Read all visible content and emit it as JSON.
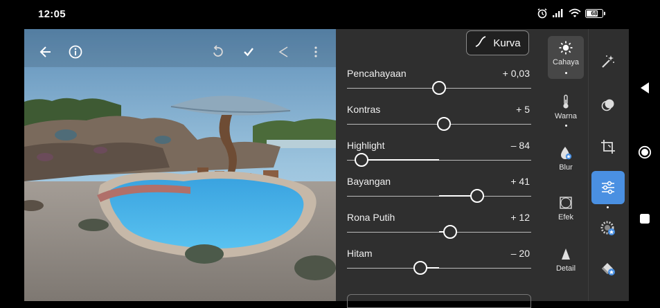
{
  "status_bar": {
    "time": "12:05",
    "battery": "68",
    "icons": [
      "alarm-icon",
      "signal-icon",
      "wifi-icon",
      "battery-icon"
    ]
  },
  "photo_toolbar": {
    "icons": [
      "back-arrow-icon",
      "info-icon",
      "undo-icon",
      "check-icon",
      "share-icon",
      "more-icon"
    ]
  },
  "panel": {
    "kurva_label": "Kurva",
    "sliders": [
      {
        "label": "Pencahayaan",
        "value": "+ 0,03",
        "amount": 0.003
      },
      {
        "label": "Kontras",
        "value": "+ 5",
        "amount": 0.05
      },
      {
        "label": "Highlight",
        "value": "– 84",
        "amount": -0.84
      },
      {
        "label": "Bayangan",
        "value": "+ 41",
        "amount": 0.41
      },
      {
        "label": "Rona Putih",
        "value": "+ 12",
        "amount": 0.12
      },
      {
        "label": "Hitam",
        "value": "– 20",
        "amount": -0.2
      }
    ]
  },
  "categories": [
    {
      "label": "Cahaya",
      "icon": "sun-icon",
      "active": true
    },
    {
      "label": "Warna",
      "icon": "thermometer-icon",
      "active": false
    },
    {
      "label": "Blur",
      "icon": "blur-drop-icon",
      "active": false
    },
    {
      "label": "Efek",
      "icon": "effects-icon",
      "active": false
    },
    {
      "label": "Detail",
      "icon": "detail-triangle-icon",
      "active": false
    }
  ],
  "tools": [
    "auto-wand-icon",
    "mask-icon",
    "crop-icon",
    "adjust-sliders-icon",
    "presets-icon",
    "healing-icon"
  ],
  "navigation": [
    "back-icon",
    "home-icon",
    "recents-icon"
  ],
  "colors": {
    "accent": "#4a90e2",
    "panel_bg": "#2f2f2f"
  }
}
